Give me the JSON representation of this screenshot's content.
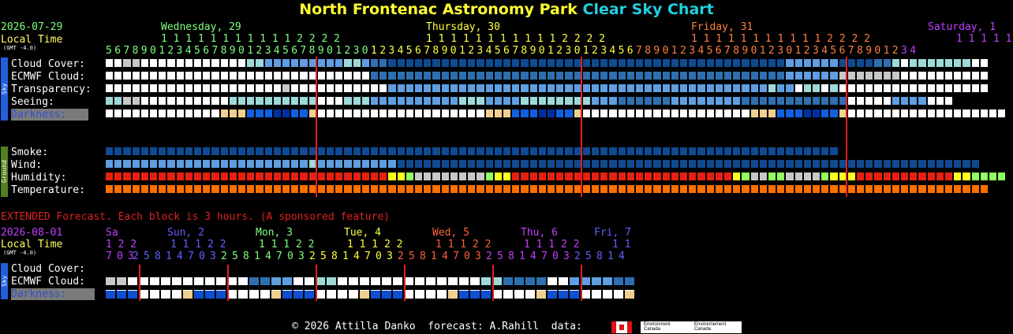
{
  "title_part1": "North Frontenac Astronomy Park",
  "title_part2": "Clear Sky Chart",
  "date": "2026-07-29",
  "local_time": "Local Time",
  "gmt_offset": "(GMT -4.0)",
  "days": [
    {
      "label": "Wednesday, 29",
      "color": "#80ff80"
    },
    {
      "label": "Thursday, 30",
      "color": "#ffff40"
    },
    {
      "label": "Friday, 31",
      "color": "#ff8040"
    },
    {
      "label": "Saturday, 1",
      "color": "#c040ff"
    }
  ],
  "tens_row": {
    "wed": "1 1 1 1 1 1 1 1 1 1 1 2 2 2 2",
    "thu": "1 1 1 1 1 1 1 1 1 1 1 2 2 2 2",
    "fri": "1 1 1 1 1 1 1 1 1 1 1 2 2 2 2",
    "sat": "1 1 1 1 1"
  },
  "hour_digits": "56789012345678901234567890123012345678901234567890123012345678901234567890123012345678901234",
  "sky_labels": [
    "Cloud Cover:",
    "ECMWF Cloud:",
    "Transparency:",
    "Seeing:",
    "Darkness:"
  ],
  "ground_labels": [
    "Smoke:",
    "Wind:",
    "Humidity:",
    "Temperature:"
  ],
  "side_sky": "Sky",
  "side_ground": "Ground",
  "extended_note": "EXTENDED Forecast. Each block is 3 hours. (A sponsored feature)",
  "ext_date": "2026-08-01",
  "ext_local_time": "Local Time",
  "ext_gmt": "(GMT -4.0)",
  "ext_days": [
    {
      "label": "Sa",
      "color": "#c040ff"
    },
    {
      "label": "Sun, 2",
      "color": "#6060ff"
    },
    {
      "label": "Mon, 3",
      "color": "#80ff80"
    },
    {
      "label": "Tue, 4",
      "color": "#ffff40"
    },
    {
      "label": "Wed, 5",
      "color": "#ff6040"
    },
    {
      "label": "Thu, 6",
      "color": "#c040ff"
    },
    {
      "label": "Fri, 7",
      "color": "#6060ff"
    }
  ],
  "ext_tens": [
    "1 2 2",
    "1 1 1 2 2",
    "1 1 1 2 2",
    "1 1 1 2 2",
    "1 1 1 2 2",
    "1 1 1 2 2",
    "1 1"
  ],
  "ext_digits": [
    "703",
    "25814703",
    "25814703",
    "25814703",
    "25814703",
    "25814703",
    "25814"
  ],
  "ext_labels": [
    "Cloud Cover:",
    "ECMWF Cloud:",
    "Darkness:"
  ],
  "footer": "© 2026 Attilla Danko  forecast: A.Rahill  data:",
  "data_logo_text": [
    "Environment Canada",
    "Environnement Canada"
  ],
  "colors": {
    "white": "#ffffff",
    "light_gray": "#c8c8c8",
    "pale": "#9ed9d9",
    "light_blue": "#5f9ee0",
    "mid_blue": "#2f6fb0",
    "dark_blue": "#104a90",
    "red_line": "#e02020"
  },
  "rows": {
    "cloud": "WWGGWWWWWWWWWWWWPPLLLLLLLLLPPLMMDDDDDDDDDDDDDDDDDDDDDDDDDDDDDDDDDDDDDDDDDDDDDLLLLLLDDDDMMPWPPPPPPPWW",
    "ecmwf": "WWWWWWWWWWWWWWWWWWWWWWWWWWWWWWMMMMMMMMMMMMMMMMMMMMMMMMMMMMMMMMMMMMMMMMMMMMMMMLLLLLLGGGGGGGWWWWWWWWWW",
    "transp": "WWWWWWWWWWWWWWWWWWWWGWWWWWWWWWWWLLLLLLLLLLLLLLLLLLLLLLLLLLLLLLLLLLLLLLLLLLLPLLWPPWPWWWWWWWWWWWWWWWWW",
    "seeing": "PPGGWWWWWWWWWWPPPPPPPPPPWWWPPPLLLLLLLLLLPPPLLLLPPPPPPPPLLLMMMMMMLLLLLLLLMMMMMMMMMMMMWWWWWLLLLWWW",
    "smoke": "DDDDDDDDDDDDDDDDDDDDDDDDDDDDDDDDDDDDDDDDDDDDDDDDDDDDDDDDDDDDDDDDDDDDDDDDDDDDDDDDDDD",
    "wind": "LLLLLLLLLLLLLLLLLLLLLLLPLLLLLLLLLDDDDDDDDDDDDDDDDDDDDDDDDDDDDDDDDDDDDDDDDDDDDDDDDDDDDDDDDDDDDDDDDDD",
    "humidity": "RRRRRRRRRRRRRRRRRRRRRRRRRRRRRRRRYYgGGGGGGGGgYYRRRRRRRRRRRRRRRRRRRRRRRRRYgGGggGGGGgYYYRRRRRRRRRRRYYgggg",
    "temp": "OOOOOOOOOOOOOOOOOOOOOOOOOOOOOOOOOOOOOOOOOOOOOOOOOOOOOOOOOOOOOOOOOOOOOOOOOOOOOOOOOOOOOOOOOOOOOOOOOOOO"
  },
  "ext_rows": {
    "cloud": "GGWWWWWWWWWWWMMLLWWPPWWWWWWWWWWWWWPPMMMMWWLLLLMMPP",
    "ecmwf": "WWWWWWWWWWWWWWWWWWWWWWWWWWWWWWWWWWWWWWWWWWWWWWWWWW"
  }
}
